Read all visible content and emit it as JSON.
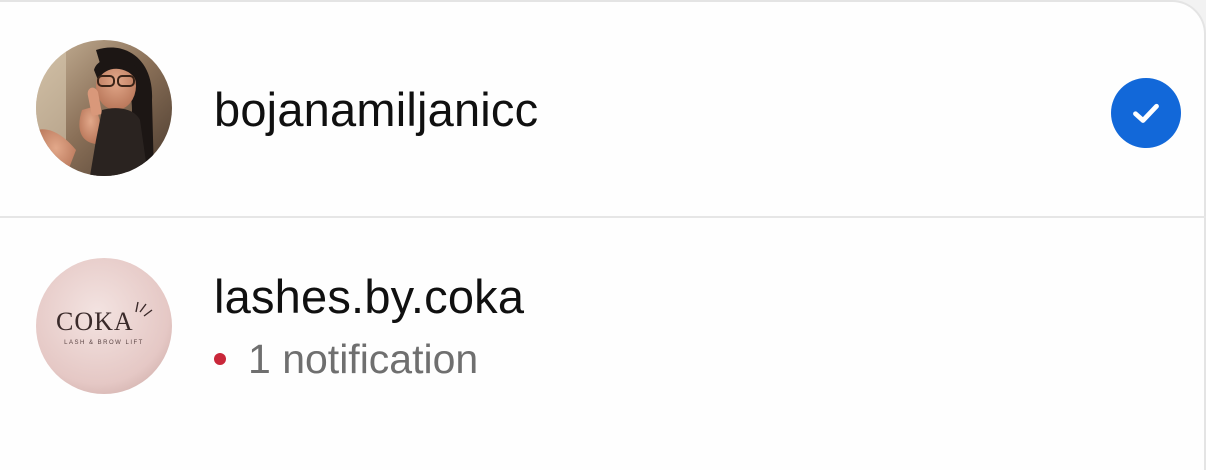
{
  "accounts": [
    {
      "username": "bojanamiljanicc",
      "avatar_icon": "profile-photo-woman-glasses",
      "selected": true
    },
    {
      "username": "lashes.by.coka",
      "avatar_icon": "coka-lash-brow-logo",
      "logo_text": "COKA",
      "logo_tagline": "LASH & BROW LIFT",
      "notification_text": "1 notification",
      "selected": false
    }
  ],
  "colors": {
    "check_blue": "#1268d9",
    "notification_dot": "#c9273a",
    "username_text": "#101010",
    "notification_text": "#6f6f6f",
    "logo_bg": "#e7cdcb"
  }
}
